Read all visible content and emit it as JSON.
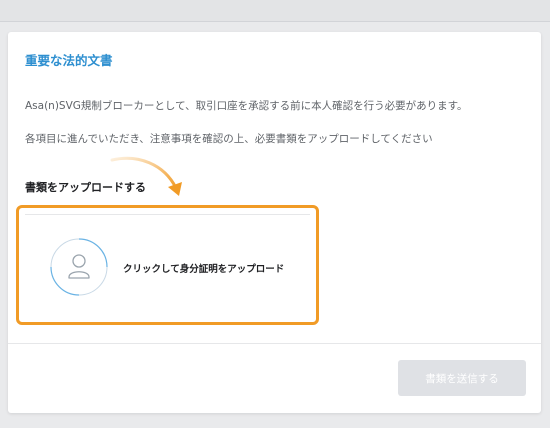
{
  "header": {
    "title": "重要な法的文書"
  },
  "content": {
    "description_1": "Asa(n)SVG規制ブローカーとして、取引口座を承認する前に本人確認を行う必要があります。",
    "description_2": "各項目に進んでいただき、注意事項を確認の上、必要書類をアップロードしてください",
    "section_label": "書類をアップロードする"
  },
  "upload": {
    "label": "クリックして身分証明をアップロード",
    "icon": "id-person-icon",
    "highlight_color": "#f19b26"
  },
  "footer": {
    "submit_label": "書類を送信する",
    "submit_state": "disabled"
  },
  "colors": {
    "accent": "#2e8fd0",
    "highlight": "#f19b26",
    "button_disabled": "#dfe1e5"
  }
}
